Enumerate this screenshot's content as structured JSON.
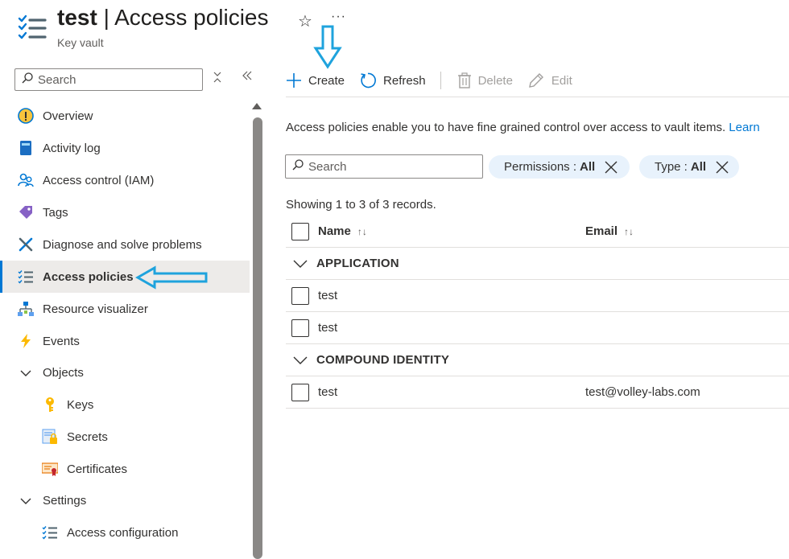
{
  "header": {
    "resource_name": "test",
    "separator": "|",
    "page_name": "Access policies",
    "resource_type": "Key vault",
    "favorite_icon": "star-icon",
    "more_label": "···"
  },
  "sidebar": {
    "search_placeholder": "Search",
    "items": [
      {
        "label": "Overview",
        "icon": "overview-icon"
      },
      {
        "label": "Activity log",
        "icon": "activity-log-icon"
      },
      {
        "label": "Access control (IAM)",
        "icon": "iam-icon"
      },
      {
        "label": "Tags",
        "icon": "tag-icon"
      },
      {
        "label": "Diagnose and solve problems",
        "icon": "wrench-icon"
      },
      {
        "label": "Access policies",
        "icon": "access-policies-icon",
        "active": true
      },
      {
        "label": "Resource visualizer",
        "icon": "resource-visualizer-icon"
      },
      {
        "label": "Events",
        "icon": "lightning-icon"
      },
      {
        "label": "Objects",
        "group": true
      },
      {
        "label": "Keys",
        "icon": "key-icon"
      },
      {
        "label": "Secrets",
        "icon": "secret-icon"
      },
      {
        "label": "Certificates",
        "icon": "certificate-icon"
      },
      {
        "label": "Settings",
        "group": true
      },
      {
        "label": "Access configuration",
        "icon": "access-configuration-icon"
      }
    ]
  },
  "toolbar": {
    "create": "Create",
    "refresh": "Refresh",
    "delete": "Delete",
    "edit": "Edit"
  },
  "info": {
    "text": "Access policies enable you to have fine grained control over access to vault items.",
    "link": "Learn"
  },
  "filters": {
    "search_placeholder": "Search",
    "permissions_label": "Permissions :",
    "permissions_value": "All",
    "type_label": "Type :",
    "type_value": "All"
  },
  "records_text": "Showing 1 to 3 of 3 records.",
  "table": {
    "columns": {
      "name": "Name",
      "email": "Email"
    },
    "groups": [
      {
        "title": "APPLICATION",
        "rows": [
          {
            "name": "test",
            "email": ""
          },
          {
            "name": "test",
            "email": ""
          }
        ]
      },
      {
        "title": "COMPOUND IDENTITY",
        "rows": [
          {
            "name": "test",
            "email": "test@volley-labs.com"
          }
        ]
      }
    ]
  },
  "colors": {
    "accent": "#0078d4",
    "annotation_arrow": "#1fa3dd",
    "filter_pill": "#e8f2fc",
    "active_nav": "#edebe9"
  }
}
